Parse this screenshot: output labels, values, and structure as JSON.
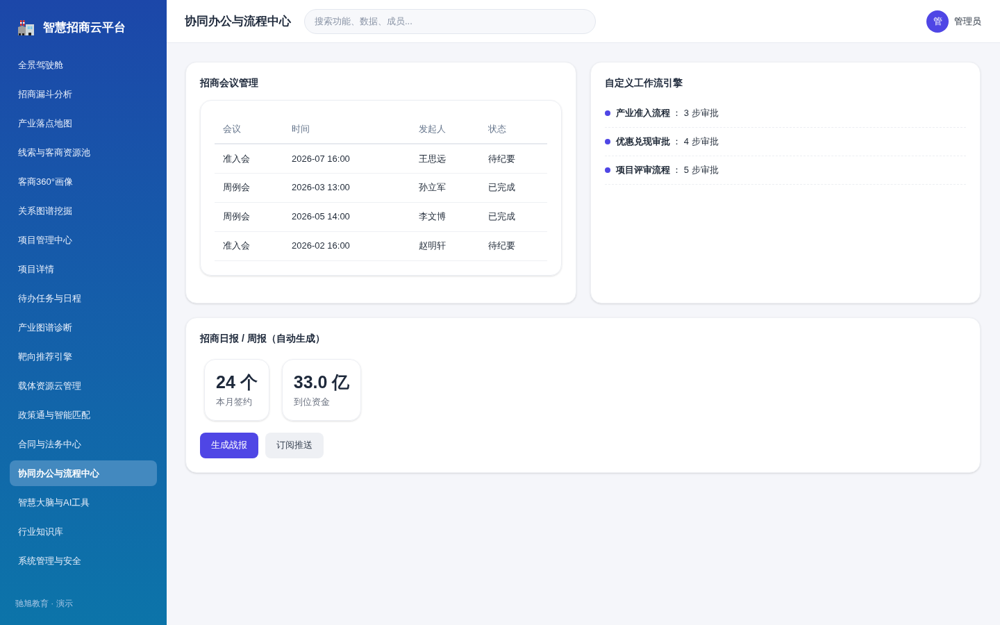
{
  "sidebar": {
    "logo_title": "智慧招商云平台",
    "items": [
      {
        "label": "全景驾驶舱",
        "selected": false
      },
      {
        "label": "招商漏斗分析",
        "selected": false
      },
      {
        "label": "产业落点地图",
        "selected": false
      },
      {
        "label": "线索与客商资源池",
        "selected": false
      },
      {
        "label": "客商360°画像",
        "selected": false
      },
      {
        "label": "关系图谱挖掘",
        "selected": false
      },
      {
        "label": "项目管理中心",
        "selected": false
      },
      {
        "label": "项目详情",
        "selected": false
      },
      {
        "label": "待办任务与日程",
        "selected": false
      },
      {
        "label": "产业图谱诊断",
        "selected": false
      },
      {
        "label": "靶向推荐引擎",
        "selected": false
      },
      {
        "label": "载体资源云管理",
        "selected": false
      },
      {
        "label": "政策通与智能匹配",
        "selected": false
      },
      {
        "label": "合同与法务中心",
        "selected": false
      },
      {
        "label": "协同办公与流程中心",
        "selected": true
      },
      {
        "label": "智慧大脑与AI工具",
        "selected": false
      },
      {
        "label": "行业知识库",
        "selected": false
      },
      {
        "label": "系统管理与安全",
        "selected": false
      }
    ],
    "footer": "驰旭教育 · 演示"
  },
  "header": {
    "title": "协同办公与流程中心",
    "search": {
      "placeholder": "搜索功能、数据、成员..."
    },
    "user": {
      "avatar": "管",
      "name": "管理员"
    }
  },
  "meetings": {
    "title": "招商会议管理",
    "columns": [
      "会议",
      "时间",
      "发起人",
      "状态"
    ],
    "rows": [
      [
        "准入会",
        "2026-07 16:00",
        "王思远",
        "待纪要"
      ],
      [
        "周例会",
        "2026-03 13:00",
        "孙立军",
        "已完成"
      ],
      [
        "周例会",
        "2026-05 14:00",
        "李文博",
        "已完成"
      ],
      [
        "准入会",
        "2026-02 16:00",
        "赵明轩",
        "待纪要"
      ]
    ]
  },
  "workflows": {
    "title": "自定义工作流引擎",
    "items": [
      {
        "text": "**产业准入流程** ： 3 步审批"
      },
      {
        "text": "**优惠兑现审批** ： 4 步审批"
      },
      {
        "text": "**项目评审流程** ： 5 步审批"
      }
    ]
  },
  "report": {
    "title": "招商日报 / 周报（自动生成）",
    "stats": [
      {
        "value": "24 个",
        "label": "本月签约"
      },
      {
        "value": "33.0 亿",
        "label": "到位资金"
      }
    ],
    "buttons": [
      {
        "label": "生成战报",
        "kind": "primary"
      },
      {
        "label": "订阅推送",
        "kind": "secondary"
      }
    ]
  }
}
